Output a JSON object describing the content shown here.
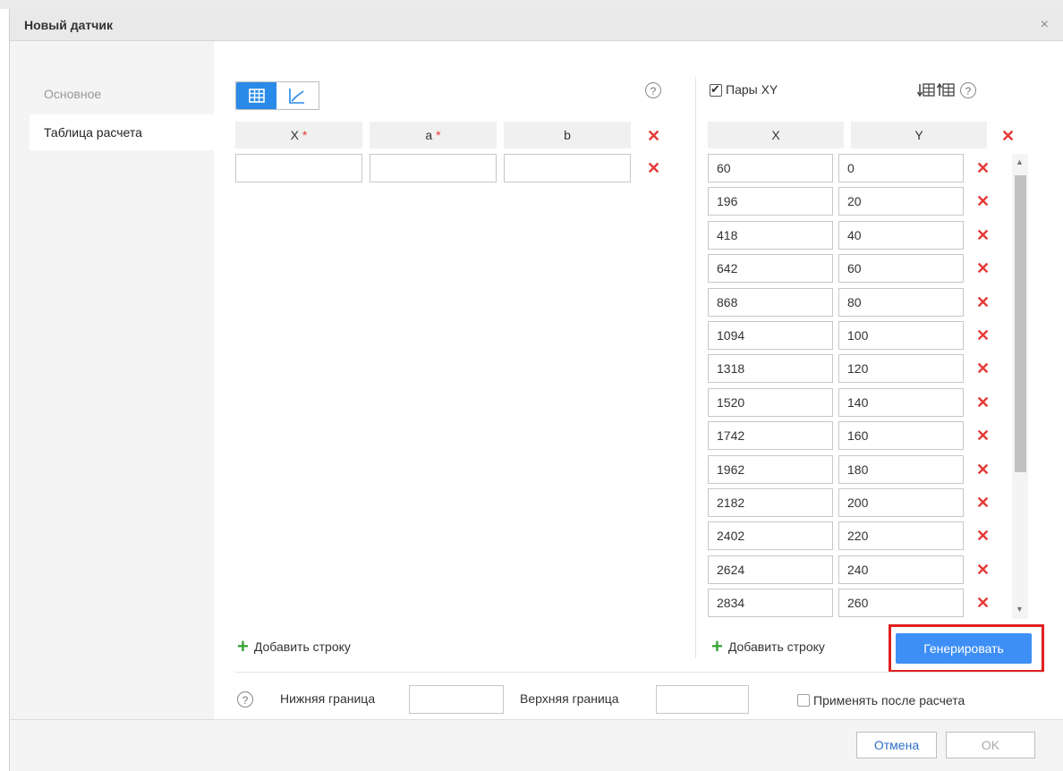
{
  "dialog": {
    "title": "Новый датчик",
    "close_label": "×"
  },
  "nav": {
    "items": [
      {
        "label": "Основное"
      },
      {
        "label": "Таблица расчета"
      }
    ]
  },
  "calc_table": {
    "columns": [
      {
        "label": "X",
        "required": true
      },
      {
        "label": "a",
        "required": true
      },
      {
        "label": "b",
        "required": false
      }
    ],
    "required_mark": "*",
    "rows": [
      [
        "",
        "",
        ""
      ]
    ],
    "add_row_label": "Добавить строку"
  },
  "xy_pairs": {
    "checkbox_label": "Пары XY",
    "checked": true,
    "columns": [
      "X",
      "Y"
    ],
    "rows": [
      [
        "60",
        "0"
      ],
      [
        "196",
        "20"
      ],
      [
        "418",
        "40"
      ],
      [
        "642",
        "60"
      ],
      [
        "868",
        "80"
      ],
      [
        "1094",
        "100"
      ],
      [
        "1318",
        "120"
      ],
      [
        "1520",
        "140"
      ],
      [
        "1742",
        "160"
      ],
      [
        "1962",
        "180"
      ],
      [
        "2182",
        "200"
      ],
      [
        "2402",
        "220"
      ],
      [
        "2624",
        "240"
      ],
      [
        "2834",
        "260"
      ]
    ],
    "add_row_label": "Добавить строку",
    "generate_label": "Генерировать"
  },
  "bounds": {
    "lower_label": "Нижняя граница",
    "lower_value": "",
    "upper_label": "Верхняя граница",
    "upper_value": "",
    "apply_after_label": "Применять после расчета"
  },
  "footer": {
    "cancel_label": "Отмена",
    "ok_label": "OK"
  },
  "icons": {
    "delete": "close-x-icon",
    "help": "help-circle-icon",
    "add": "plus-icon",
    "table_view": "table-grid-icon",
    "chart_view": "line-chart-icon",
    "sort_asc": "sort-table-down-icon",
    "sort_desc": "sort-table-up-icon"
  },
  "help_glyph": "?",
  "delete_glyph": "✕",
  "colors": {
    "accent": "#3d8ef5",
    "delete": "#e53935",
    "add": "#3aa53a",
    "highlight": "#e02020"
  }
}
